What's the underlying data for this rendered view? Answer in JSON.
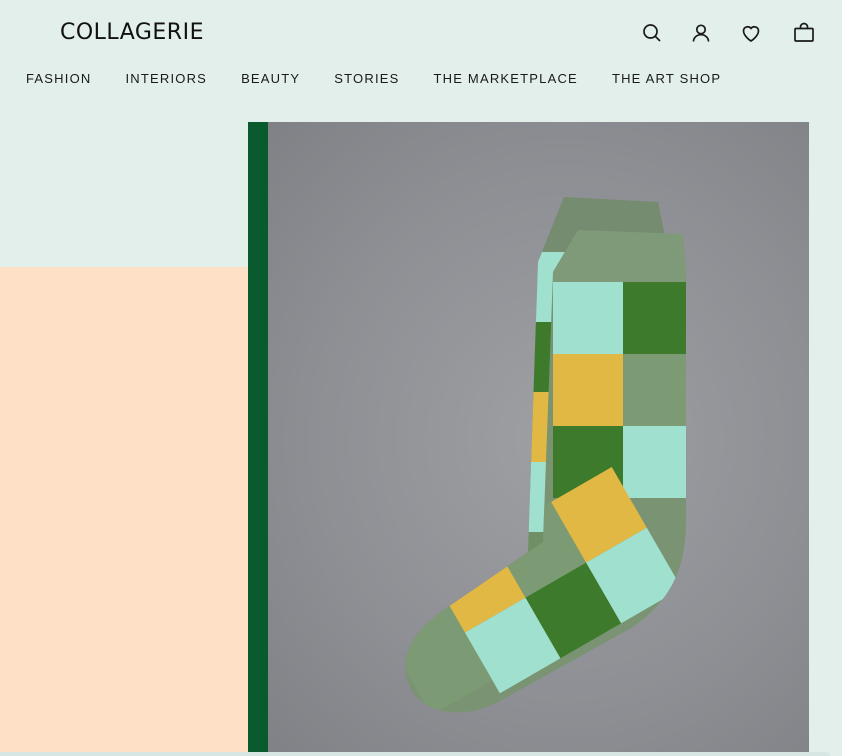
{
  "header": {
    "logo_text": "COLLAGERIE",
    "icons": [
      "search-icon",
      "account-icon",
      "wishlist-heart-icon",
      "bag-icon"
    ]
  },
  "nav": {
    "items": [
      {
        "label": "FASHION"
      },
      {
        "label": "INTERIORS"
      },
      {
        "label": "BEAUTY"
      },
      {
        "label": "STORIES"
      },
      {
        "label": "THE MARKETPLACE"
      },
      {
        "label": "THE ART SHOP"
      }
    ]
  },
  "colors": {
    "page_background": "#e2efea",
    "peach_panel": "#fde0c5",
    "accent_green_bar": "#0a5a2f",
    "image_background": "#8d8f94"
  }
}
